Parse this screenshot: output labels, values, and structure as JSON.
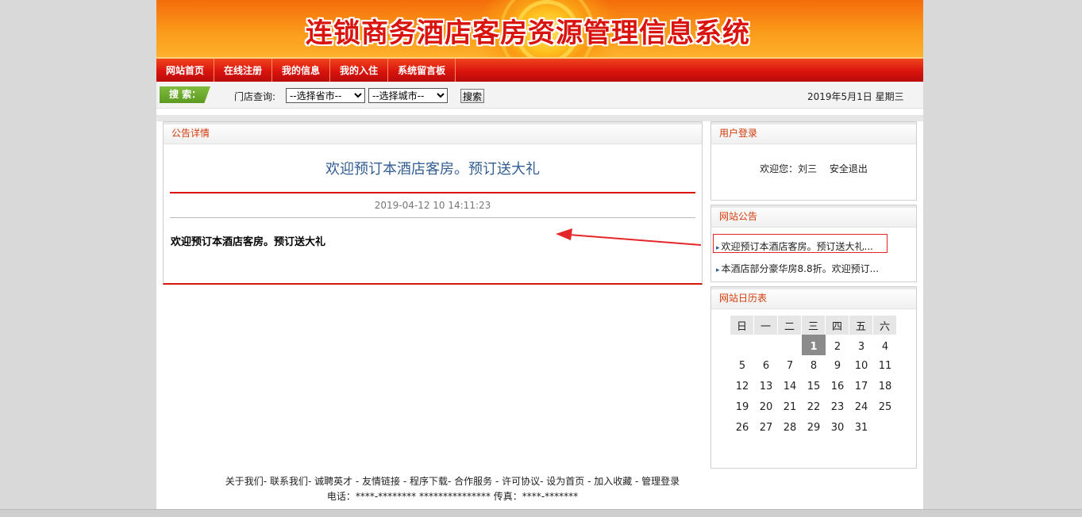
{
  "header": {
    "site_title": "连锁商务酒店客房资源管理信息系统"
  },
  "nav": {
    "items": [
      "网站首页",
      "在线注册",
      "我的信息",
      "我的入住",
      "系统留言板"
    ]
  },
  "search": {
    "tag": "搜 索：",
    "store_label": "门店查询:",
    "province_select": "--选择省市--",
    "city_select": "--选择城市--",
    "button": "搜索",
    "date": "2019年5月1日 星期三"
  },
  "main": {
    "panel_title": "公告详情",
    "notice_title": "欢迎预订本酒店客房。预订送大礼",
    "notice_date": "2019-04-12 10 14:11:23",
    "notice_body": "欢迎预订本酒店客房。预订送大礼"
  },
  "sidebar": {
    "login": {
      "title": "用户登录",
      "welcome": "欢迎您：刘三",
      "logout": "安全退出"
    },
    "news": {
      "title": "网站公告",
      "items": [
        "欢迎预订本酒店客房。预订送大礼...",
        "本酒店部分豪华房8.8折。欢迎预订..."
      ]
    },
    "calendar": {
      "title": "网站日历表",
      "weekdays": [
        "日",
        "一",
        "二",
        "三",
        "四",
        "五",
        "六"
      ],
      "today": "1",
      "weeks": [
        [
          "",
          "",
          "",
          "1",
          "2",
          "3",
          "4"
        ],
        [
          "5",
          "6",
          "7",
          "8",
          "9",
          "10",
          "11"
        ],
        [
          "12",
          "13",
          "14",
          "15",
          "16",
          "17",
          "18"
        ],
        [
          "19",
          "20",
          "21",
          "22",
          "23",
          "24",
          "25"
        ],
        [
          "26",
          "27",
          "28",
          "29",
          "30",
          "31",
          ""
        ]
      ]
    }
  },
  "footer": {
    "links": "关于我们- 联系我们- 诚聘英才 - 友情链接 - 程序下载- 合作服务 - 许可协议- 设为首页 - 加入收藏 - 管理登录",
    "contact": "电话：****-******** *************** 传真：****-*******"
  },
  "colors": {
    "brand_red": "#d9140e",
    "banner_orange": "#fb9a1a",
    "link_blue": "#335d93",
    "annotation_red": "#e5262a"
  }
}
